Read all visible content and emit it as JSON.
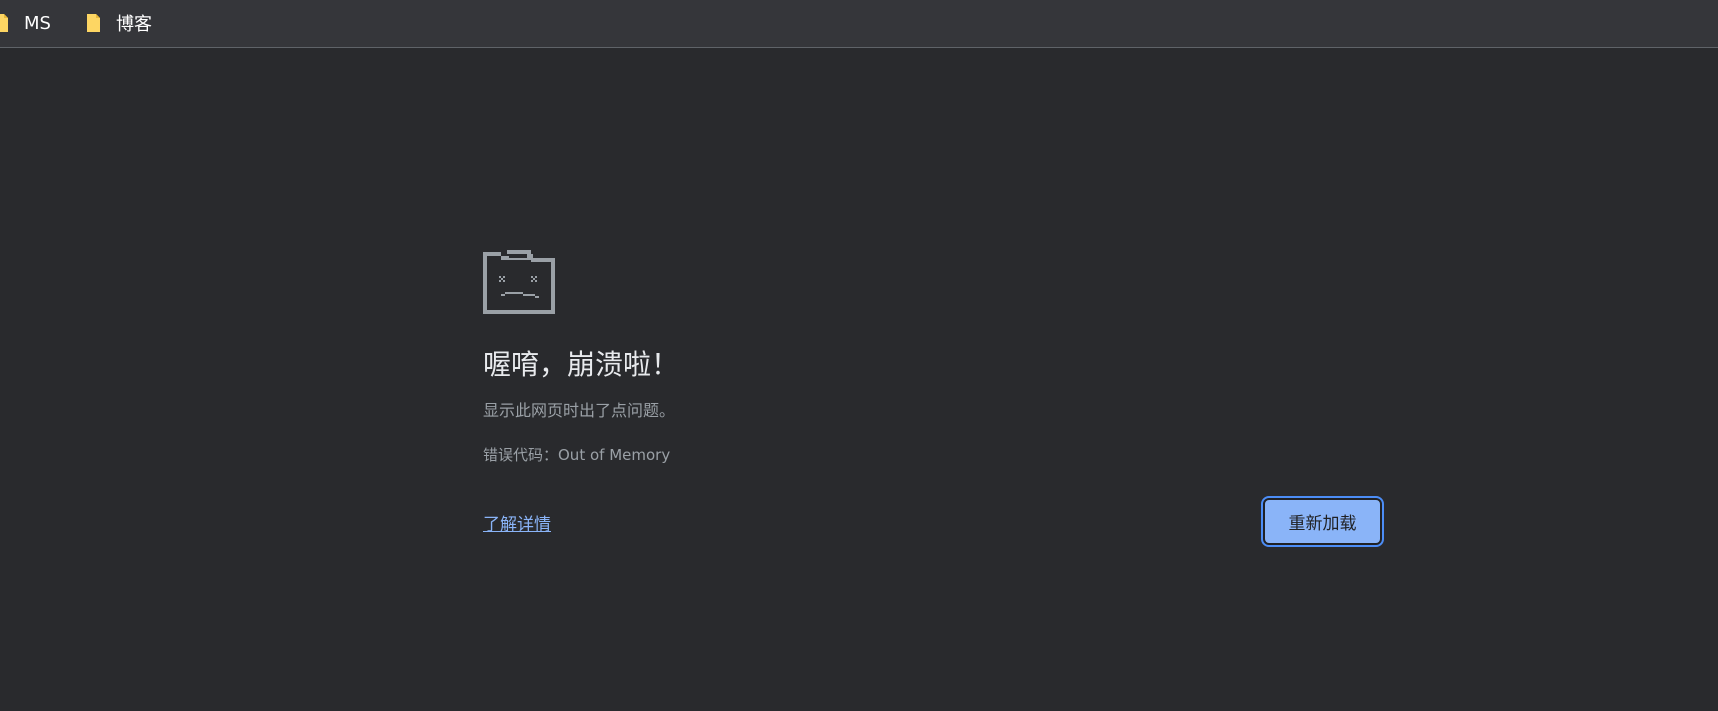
{
  "bookmarks": {
    "items": [
      {
        "label": "MS",
        "icon": "folder-icon"
      },
      {
        "label": "博客",
        "icon": "folder-icon"
      }
    ]
  },
  "crash_page": {
    "icon": "sad-folder-icon",
    "title": "喔唷，崩溃啦！",
    "subtitle": "显示此网页时出了点问题。",
    "error_code": "错误代码：Out of Memory",
    "learn_more_label": "了解详情",
    "reload_label": "重新加载"
  },
  "colors": {
    "background": "#292a2d",
    "bookmarks_bar": "#35363a",
    "folder": "#fdd663",
    "link": "#8ab4f8",
    "button": "#8ab4f8",
    "icon_gray": "#9aa0a6"
  }
}
